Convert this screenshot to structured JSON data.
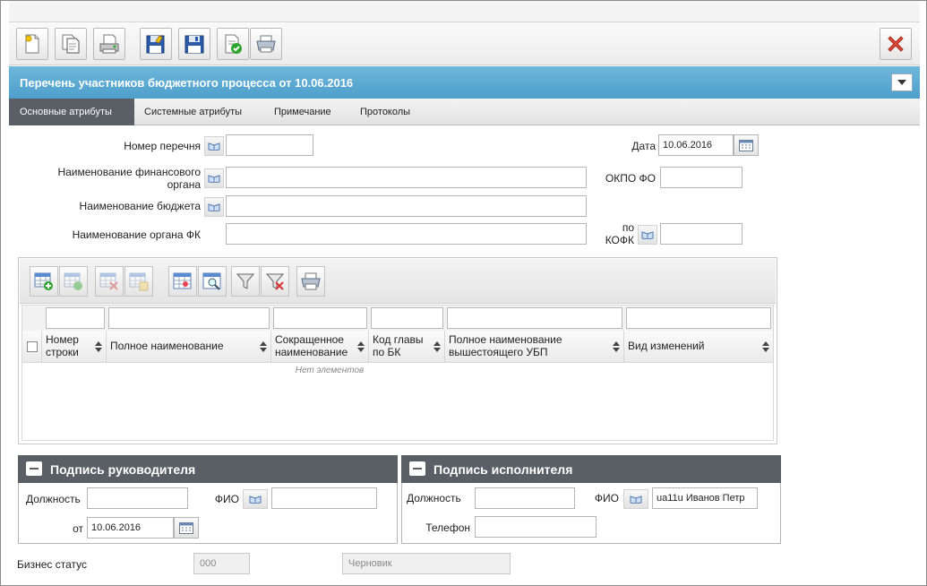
{
  "toolbar": {
    "buttons": [
      "new-document-icon",
      "copy-document-icon",
      "print-document-icon",
      "save-as-icon",
      "save-icon",
      "approve-document-icon",
      "printer-icon"
    ],
    "close_icon": "close-icon"
  },
  "title": "Перечень участников бюджетного процесса от 10.06.2016",
  "tabs": [
    {
      "label": "Основные атрибуты",
      "active": true
    },
    {
      "label": "Системные атрибуты",
      "active": false
    },
    {
      "label": "Примечание",
      "active": false
    },
    {
      "label": "Протоколы",
      "active": false
    }
  ],
  "form": {
    "list_number_label": "Номер перечня",
    "list_number_value": "",
    "date_label": "Дата",
    "date_value": "10.06.2016",
    "fin_org_label_1": "Наименование финансового",
    "fin_org_label_2": "органа",
    "fin_org_value": "",
    "okpo_label": "ОКПО ФО",
    "okpo_value": "",
    "budget_label": "Наименование бюджета",
    "budget_value": "",
    "fk_label": "Наименование органа ФК",
    "fk_value": "",
    "kofk_label_1": "по",
    "kofk_label_2": "КОФК",
    "kofk_value": ""
  },
  "grid": {
    "toolbar_icons": [
      "add-row-icon",
      "edit-row-icon",
      "delete-row-icon",
      "copy-row-icon",
      "table-settings-icon",
      "table-search-icon",
      "filter-icon",
      "clear-filter-icon",
      "print-grid-icon"
    ],
    "columns": [
      {
        "l1": "Номер",
        "l2": "строки"
      },
      {
        "l1": "Полное наименование",
        "l2": ""
      },
      {
        "l1": "Сокращенное",
        "l2": "наименование"
      },
      {
        "l1": "Код главы",
        "l2": "по БК"
      },
      {
        "l1": "Полное наименование",
        "l2": "вышестоящего УБП"
      },
      {
        "l1": "Вид изменений",
        "l2": ""
      }
    ],
    "empty_text": "Нет элементов"
  },
  "head_panel": {
    "title": "Подпись руководителя",
    "position_label": "Должность",
    "position_value": "",
    "fio_label": "ФИО",
    "fio_value": "",
    "from_label": "от",
    "from_value": "10.06.2016"
  },
  "exec_panel": {
    "title": "Подпись исполнителя",
    "position_label": "Должность",
    "position_value": "",
    "fio_label": "ФИО",
    "fio_value": "ua11u Иванов Петр",
    "phone_label": "Телефон",
    "phone_value": ""
  },
  "status": {
    "label": "Бизнес статус",
    "code": "000",
    "name": "Черновик"
  },
  "colors": {
    "title_bar": "#5aaad4",
    "panel_header": "#5a5f66",
    "active_tab": "#5a5f66",
    "close_red": "#e04b3a"
  }
}
